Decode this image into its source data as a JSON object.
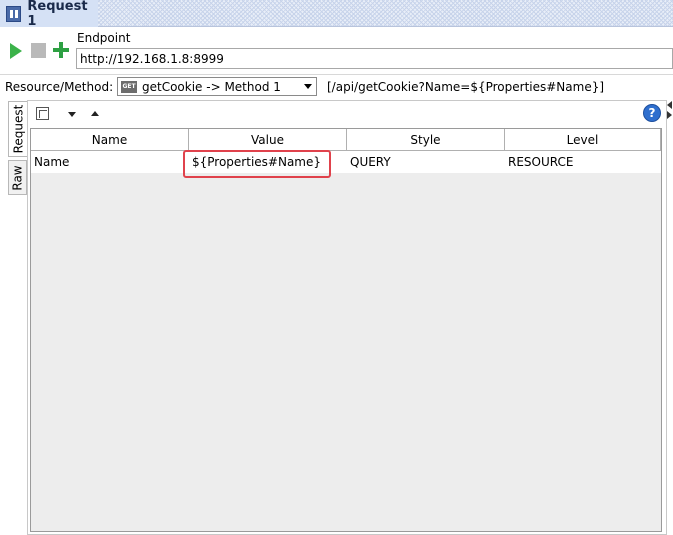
{
  "window": {
    "title": "Request 1"
  },
  "toolbar": {
    "endpoint_label": "Endpoint",
    "endpoint_value": "http://192.168.1.8:8999"
  },
  "resource": {
    "label": "Resource/Method:",
    "method_badge": "GET",
    "selected": "getCookie -> Method 1",
    "path": "[/api/getCookie?Name=${Properties#Name}]"
  },
  "tabs": {
    "request": "Request",
    "raw": "Raw"
  },
  "help_icon_text": "?",
  "params": {
    "columns": [
      "Name",
      "Value",
      "Style",
      "Level"
    ],
    "rows": [
      {
        "name": "Name",
        "value": "${Properties#Name}",
        "style": "QUERY",
        "level": "RESOURCE"
      }
    ]
  },
  "colors": {
    "play": "#3bb24a",
    "add": "#2ea043",
    "highlight": "#e0424c",
    "help": "#2f6fce"
  }
}
